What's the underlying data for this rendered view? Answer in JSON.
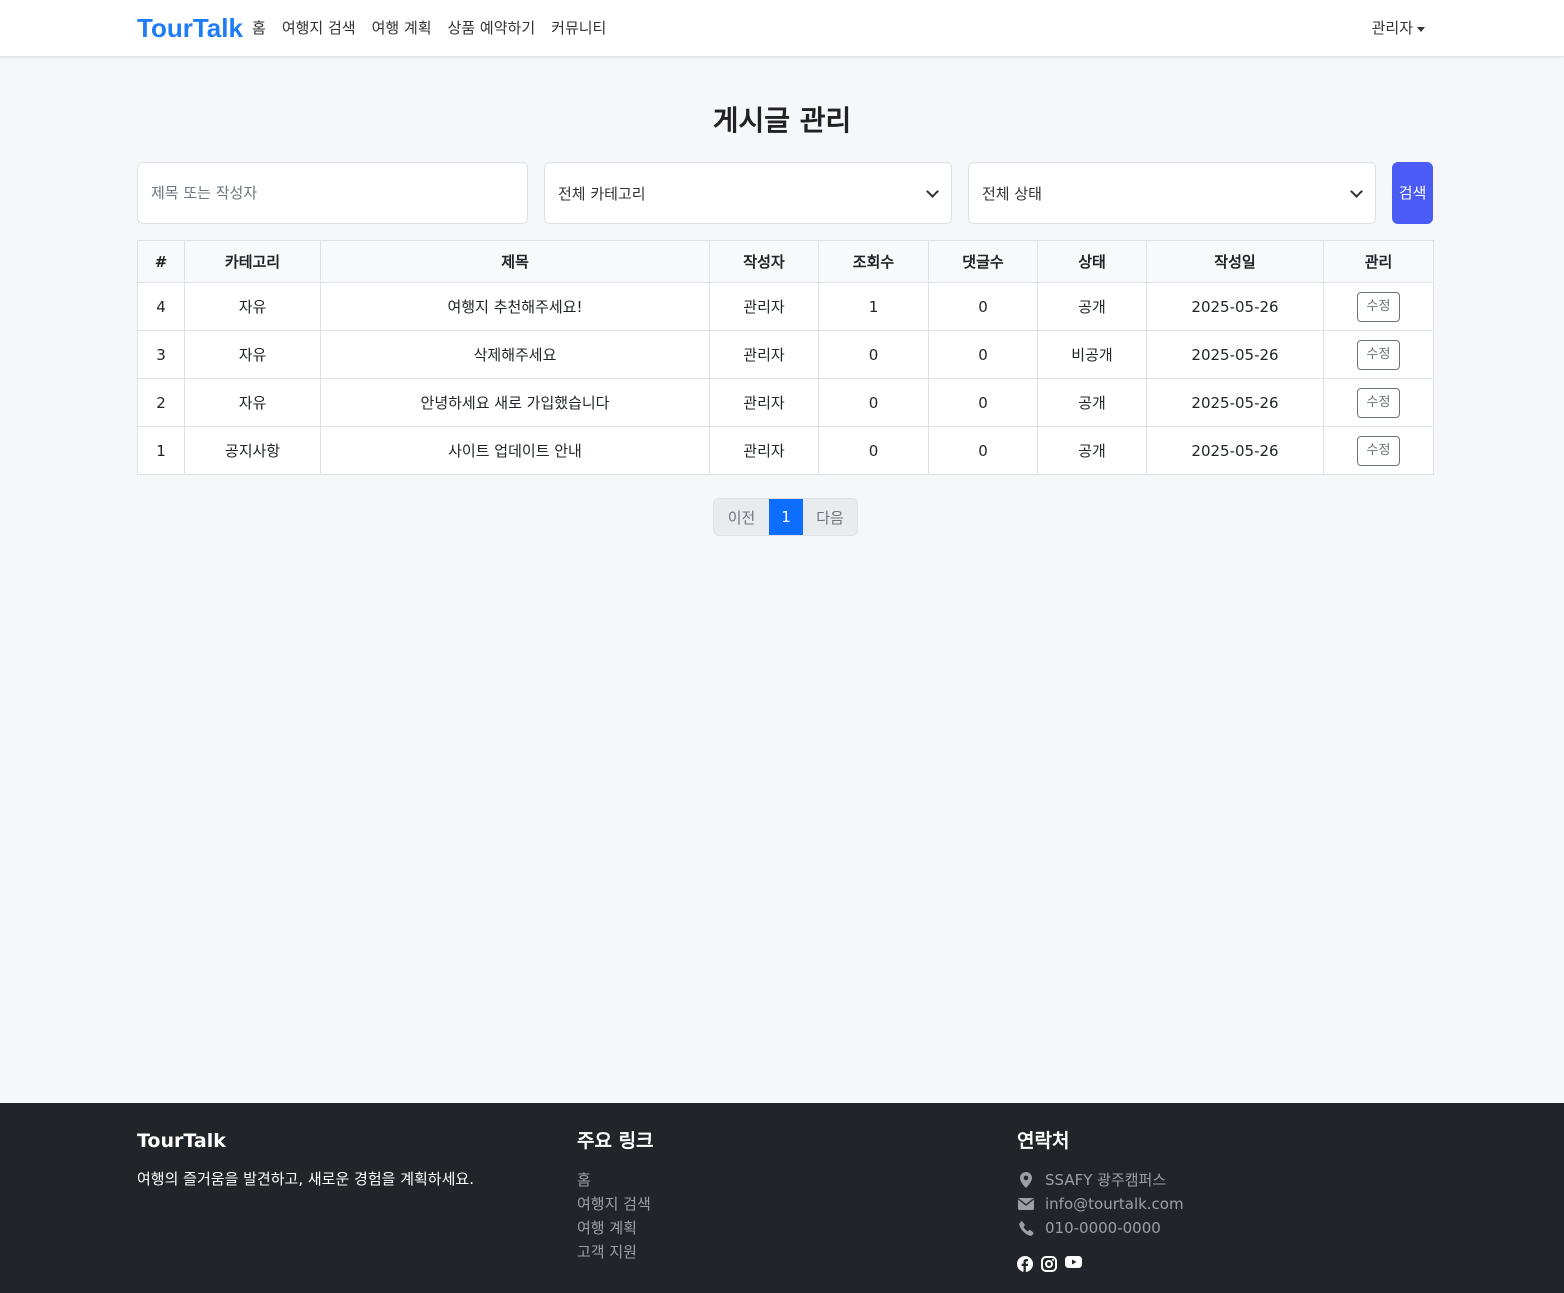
{
  "nav": {
    "brand": "TourTalk",
    "links": [
      "홈",
      "여행지 검색",
      "여행 계획",
      "상품 예약하기",
      "커뮤니티"
    ],
    "user": "관리자"
  },
  "page": {
    "title": "게시글 관리"
  },
  "filters": {
    "search_placeholder": "제목 또는 작성자",
    "category": "전체 카테고리",
    "status": "전체 상태",
    "search_button": "검색"
  },
  "table": {
    "headers": [
      "#",
      "카테고리",
      "제목",
      "작성자",
      "조회수",
      "댓글수",
      "상태",
      "작성일",
      "관리"
    ],
    "rows": [
      [
        "4",
        "자유",
        "여행지 추천해주세요!",
        "관리자",
        "1",
        "0",
        "공개",
        "2025-05-26",
        "수정"
      ],
      [
        "3",
        "자유",
        "삭제해주세요",
        "관리자",
        "0",
        "0",
        "비공개",
        "2025-05-26",
        "수정"
      ],
      [
        "2",
        "자유",
        "안녕하세요 새로 가입했습니다",
        "관리자",
        "0",
        "0",
        "공개",
        "2025-05-26",
        "수정"
      ],
      [
        "1",
        "공지사항",
        "사이트 업데이트 안내",
        "관리자",
        "0",
        "0",
        "공개",
        "2025-05-26",
        "수정"
      ]
    ]
  },
  "pagination": {
    "prev": "이전",
    "current": "1",
    "next": "다음"
  },
  "footer": {
    "about_title": "TourTalk",
    "about_text": "여행의 즐거움을 발견하고, 새로운 경험을 계획하세요.",
    "links_title": "주요 링크",
    "links": [
      "홈",
      "여행지 검색",
      "여행 계획",
      "고객 지원"
    ],
    "contact_title": "연락처",
    "address": "SSAFY 광주캠퍼스",
    "email": "info@tourtalk.com",
    "phone": "010-0000-0000"
  },
  "colors": {
    "brand": "#1e7df5",
    "search_button": "#4a5cf5",
    "active_page": "#0d6efd",
    "footer_bg": "#212529"
  }
}
